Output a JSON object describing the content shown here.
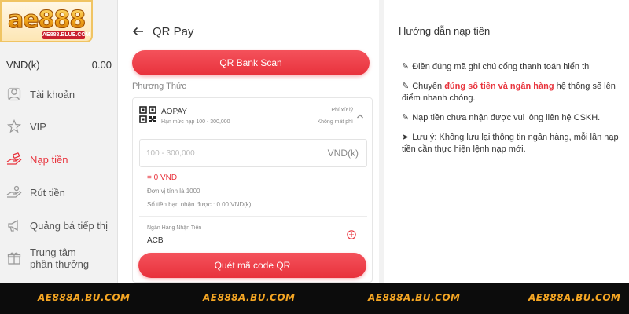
{
  "sidebar": {
    "logo": {
      "main": "ae888",
      "sub": "AE888.BLUE.COM"
    },
    "balance": {
      "currency": "VND(k)",
      "amount": "0.00"
    },
    "items": [
      {
        "label": "Tài khoản",
        "icon": "user-icon"
      },
      {
        "label": "VIP",
        "icon": "vip-star-icon"
      },
      {
        "label": "Nạp tiền",
        "icon": "deposit-hand-icon",
        "active": true
      },
      {
        "label": "Rút tiền",
        "icon": "withdraw-hand-icon"
      },
      {
        "label": "Quảng bá tiếp thị",
        "icon": "share-icon"
      },
      {
        "label": "Trung tâm phần thưởng",
        "icon": "gift-icon"
      }
    ]
  },
  "deposit": {
    "title": "QR Pay",
    "bank_scan_button": "QR Bank Scan",
    "method_label": "Phương Thức",
    "pay_method": {
      "name": "AOPAY",
      "limit": "Hạn mức nạp 100 - 300,000",
      "fee_label": "Phí xử lý",
      "fee_value": "Không mất phí"
    },
    "amount_input": {
      "placeholder": "100 - 300,000",
      "value": "",
      "unit": "VND(k)"
    },
    "result": "= 0 VND",
    "unit_info": "Đơn vị tính là 1000",
    "received_info": "Số tiền bạn nhận được : 0.00 VND(k)",
    "bank_field": {
      "label": "Ngân Hàng Nhận Tiền",
      "value": "ACB"
    },
    "scan_qr_button": "Quét mã code QR"
  },
  "guide": {
    "title": "Hướng dẫn nạp tiền",
    "items": [
      {
        "mark": "✎",
        "parts": [
          "Điền đúng mã ghi chú cổng thanh toán hiển thị"
        ]
      },
      {
        "mark": "✎",
        "before": "Chuyển ",
        "highlight": "đúng số tiền và ngân hàng",
        "after": " hệ thống sẽ lên điểm nhanh chóng."
      },
      {
        "mark": "✎",
        "parts": [
          "Nạp tiền chưa nhận được vui lòng liên hệ CSKH."
        ]
      },
      {
        "mark": "➤",
        "parts": [
          "Lưu ý: Không lưu lại thông tin ngân hàng, mỗi lần nạp tiền cần thực hiện lệnh nạp mới."
        ]
      }
    ]
  },
  "footer": {
    "items": [
      "AE888A.BU.COM",
      "AE888A.BU.COM",
      "AE888A.BU.COM",
      "AE888A.BU.COM"
    ]
  },
  "colors": {
    "accent": "#e8333c",
    "footer_text": "#f5a623",
    "footer_bg": "#0c0c0c"
  }
}
